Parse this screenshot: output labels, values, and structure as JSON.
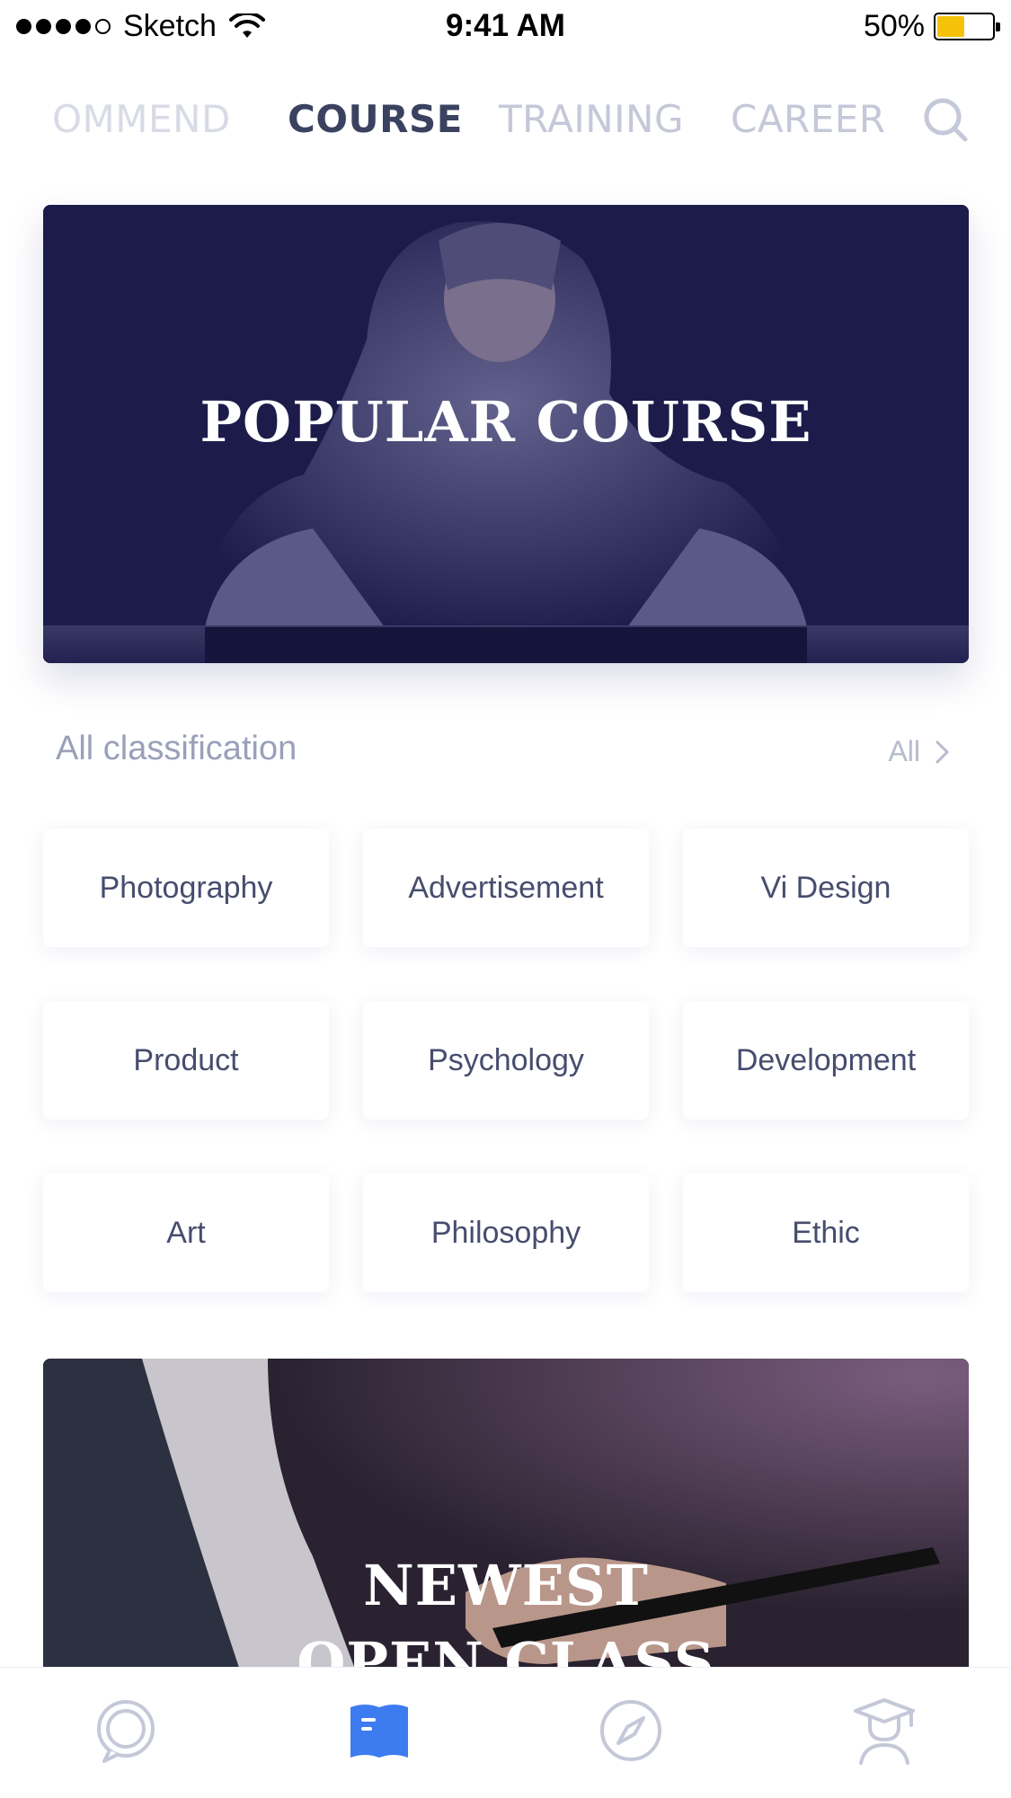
{
  "status_bar": {
    "carrier": "Sketch",
    "time": "9:41 AM",
    "battery_percent": "50%",
    "battery_level": 0.5,
    "battery_color": "#f5c20a"
  },
  "top_tabs": [
    {
      "label": "OMMEND",
      "active": false
    },
    {
      "label": "COURSE",
      "active": true
    },
    {
      "label": "TRAINING",
      "active": false
    },
    {
      "label": "CAREER",
      "active": false
    }
  ],
  "search": {
    "icon": "search-icon"
  },
  "hero": {
    "title": "POPULAR COURSE",
    "overlay_color": "#1c1b4a"
  },
  "classification": {
    "title": "All classification",
    "see_all_label": "All"
  },
  "categories": [
    "Photography",
    "Advertisement",
    "Vi Design",
    "Product",
    "Psychology",
    "Development",
    "Art",
    "Philosophy",
    "Ethic"
  ],
  "banner2": {
    "title_line1": "NEWEST",
    "title_line2": "OPEN CLASS"
  },
  "bottom_nav": [
    {
      "icon": "chat-bubble-icon",
      "active": false
    },
    {
      "icon": "book-icon",
      "active": true
    },
    {
      "icon": "compass-icon",
      "active": false
    },
    {
      "icon": "graduate-icon",
      "active": false
    }
  ],
  "colors": {
    "accent": "#3d7cf0",
    "text_dark": "#3b4260",
    "text_muted": "#9aa0b8"
  }
}
